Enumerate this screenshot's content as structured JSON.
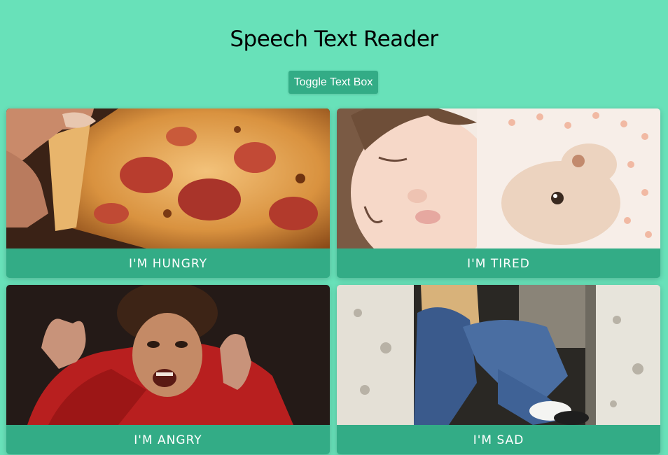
{
  "header": {
    "title": "Speech Text Reader",
    "toggle_label": "Toggle Text Box"
  },
  "cards": [
    {
      "label": "I'M HUNGRY",
      "image": "pizza-photo"
    },
    {
      "label": "I'M TIRED",
      "image": "sleeping-child-photo"
    },
    {
      "label": "I'M ANGRY",
      "image": "angry-child-photo"
    },
    {
      "label": "I'M SAD",
      "image": "sad-child-photo"
    }
  ],
  "colors": {
    "background": "#68e1b9",
    "accent": "#33ac86",
    "text_light": "#ffffff"
  }
}
